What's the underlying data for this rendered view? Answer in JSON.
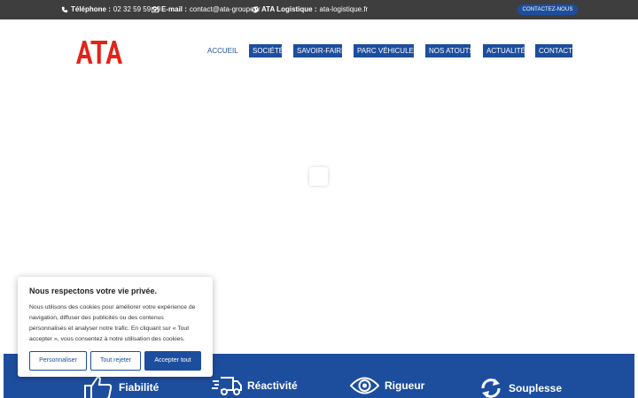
{
  "topbar": {
    "phone_label": "Téléphone :",
    "phone_value": "02 32 59 59 99",
    "email_label": "E-mail :",
    "email_value": "contact@ata-groupe.fr",
    "logistics_label": "ATA Logistique :",
    "logistics_value": "ata-logistique.fr",
    "cta_label": "CONTACTEZ-NOUS"
  },
  "header": {
    "logo_text": "ATA",
    "nav": [
      "ACCUEIL",
      "SOCIÉTÉ",
      "SAVOIR-FAIRE",
      "PARC VÉHICULES",
      "NOS ATOUTS",
      "ACTUALITÉ",
      "CONTACT"
    ],
    "active_nav": "ACCUEIL"
  },
  "features": [
    {
      "label": "Fiabilité",
      "icon": "thumbs-up-icon"
    },
    {
      "label": "Réactivité",
      "icon": "fast-truck-icon"
    },
    {
      "label": "Rigueur",
      "icon": "eye-icon"
    },
    {
      "label": "Souplesse",
      "icon": "refresh-icon"
    }
  ],
  "cookie": {
    "title": "Nous respectons votre vie privée.",
    "text": "Nous utilisons des cookies pour améliorer votre expérience de navigation, diffuser des publicités ou des contenus personnalisés et analyser notre trafic. En cliquant sur « Tout accepter », vous consentez à notre utilisation des cookies.",
    "customize_label": "Personnaliser",
    "reject_label": "Tout rejeter",
    "accept_label": "Accepter tout"
  },
  "colors": {
    "brand_blue": "#1d4e9e",
    "logo_red": "#e2231a",
    "topbar_bg": "#3e3e3e"
  }
}
